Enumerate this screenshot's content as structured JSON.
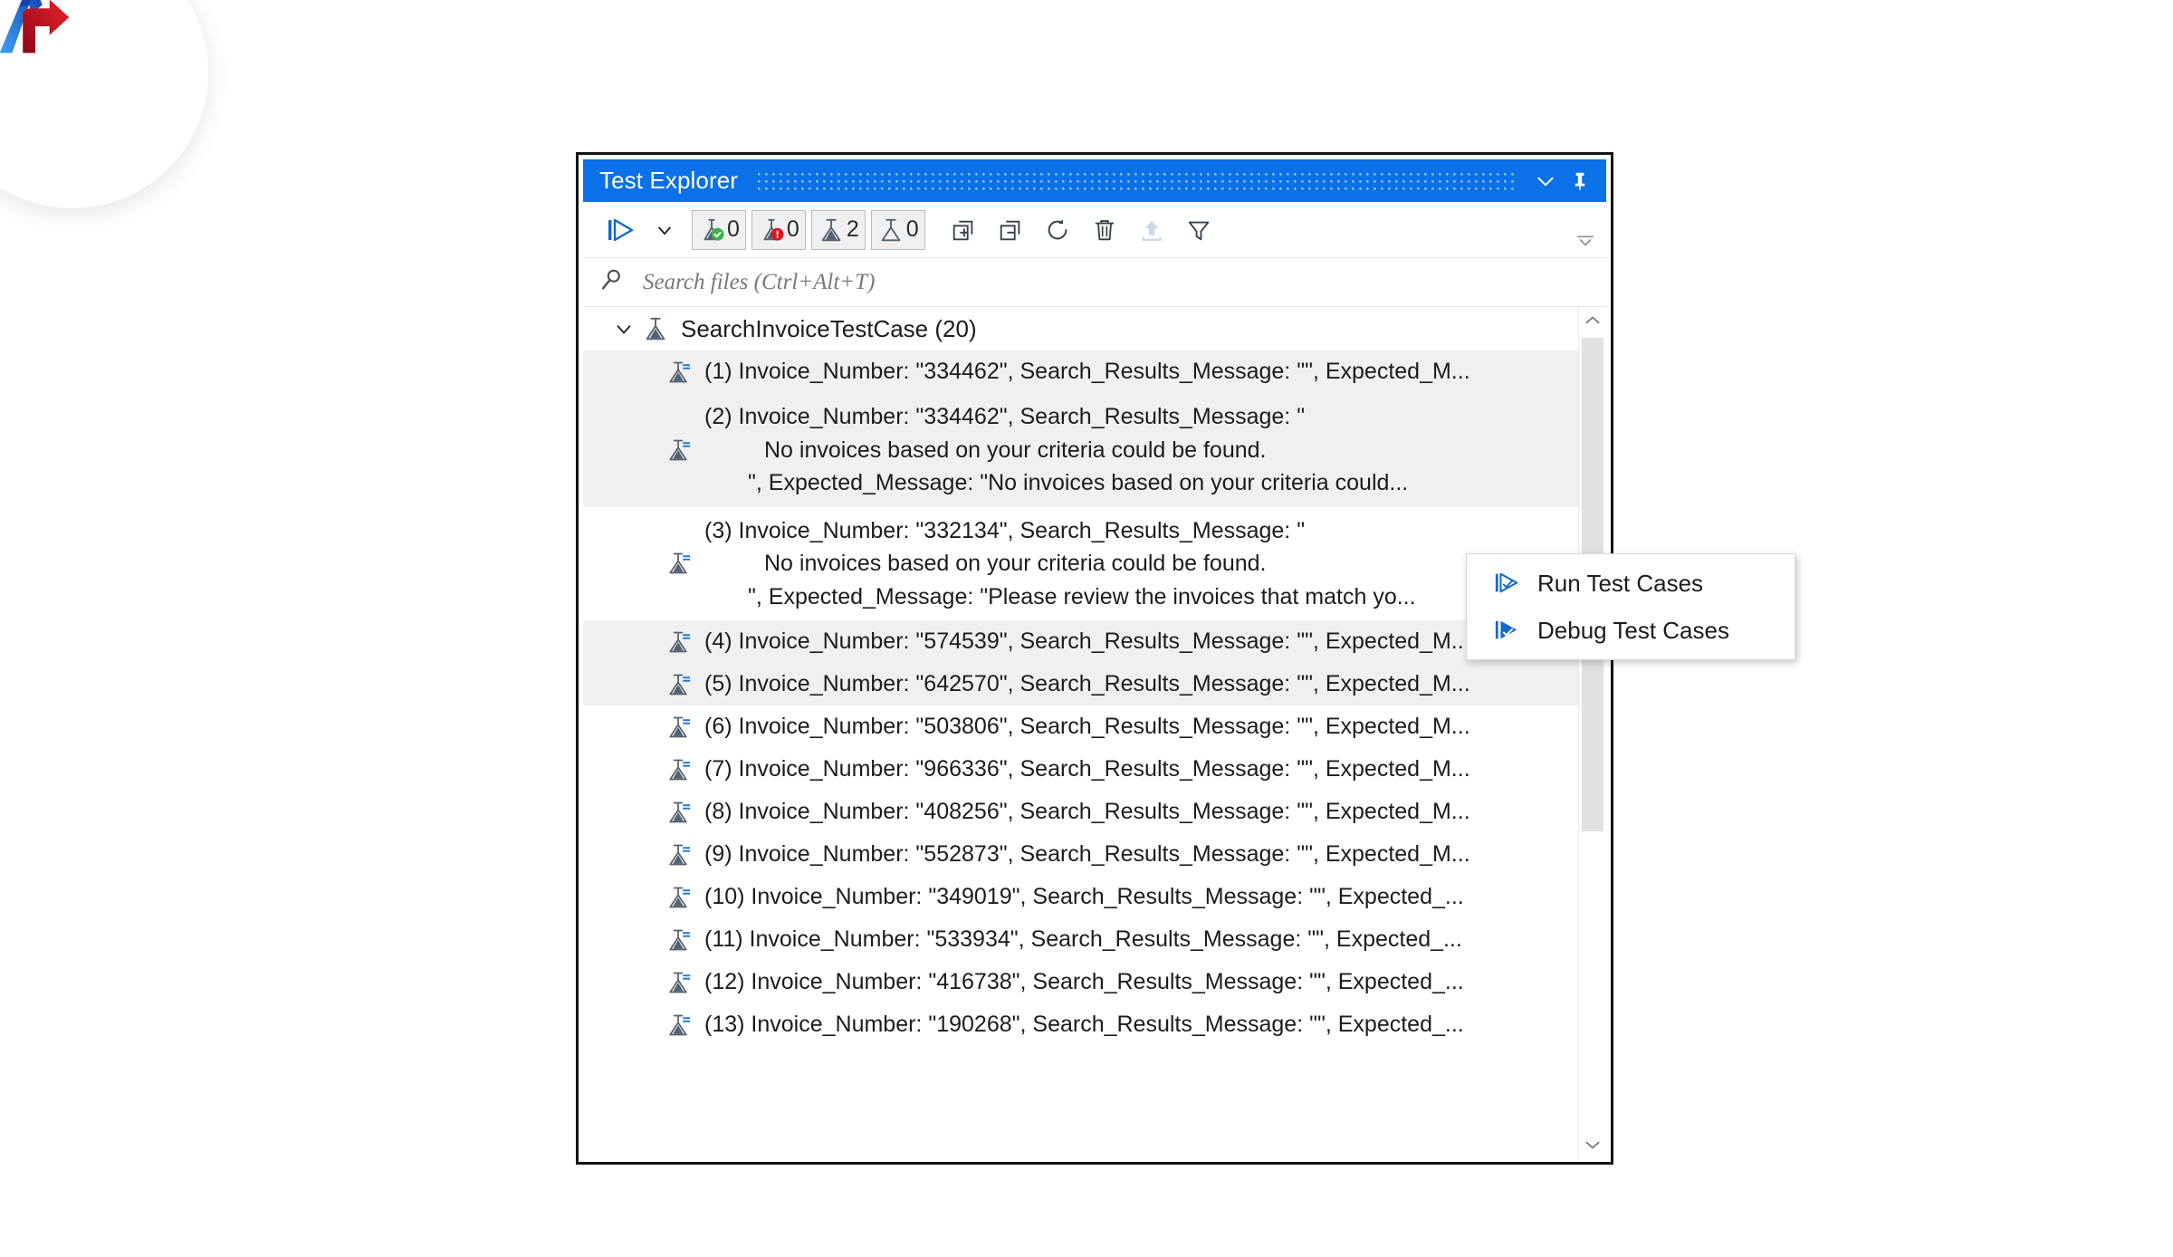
{
  "branding": {
    "logo_name": "accelq-logo"
  },
  "window": {
    "title": "Test Explorer",
    "collapse_icon": "chevron-down-icon",
    "pin_icon": "pin-icon"
  },
  "toolbar": {
    "run_icon": "run-all-tests-icon",
    "run_caret_icon": "chevron-down-icon",
    "counters": [
      {
        "name": "passed-tests-count",
        "icon": "flask-passed-icon",
        "value": "0"
      },
      {
        "name": "failed-tests-count",
        "icon": "flask-failed-icon",
        "value": "0"
      },
      {
        "name": "not-run-tests-count",
        "icon": "flask-notrun-icon",
        "value": "2"
      },
      {
        "name": "skipped-tests-count",
        "icon": "flask-skipped-icon",
        "value": "0"
      }
    ],
    "actions": [
      {
        "name": "expand-all-button",
        "icon": "expand-all-icon"
      },
      {
        "name": "collapse-all-button",
        "icon": "collapse-all-icon"
      },
      {
        "name": "refresh-button",
        "icon": "refresh-icon"
      },
      {
        "name": "clear-all-button",
        "icon": "trash-icon"
      },
      {
        "name": "export-results-button",
        "icon": "upload-icon"
      },
      {
        "name": "filter-button",
        "icon": "funnel-filter-icon"
      }
    ],
    "overflow_icon": "toolbar-overflow-icon",
    "colors": {
      "pass_green": "#3fae49",
      "fail_red": "#d31b27",
      "accent_blue": "#0a71e8",
      "icon_gray": "#546170"
    }
  },
  "search": {
    "icon": "search-icon",
    "value": "",
    "placeholder": "Search files (Ctrl+Alt+T)"
  },
  "tree": {
    "group": {
      "caret_icon": "chevron-down-icon",
      "icon": "flask-icon",
      "label": "SearchInvoiceTestCase (20)"
    },
    "rows": [
      {
        "name": "test-case-row-1",
        "icon": "flask-notrun-icon",
        "multiline": false,
        "highlighted": true,
        "lines": [
          "(1) Invoice_Number: \"334462\", Search_Results_Message: \"\", Expected_M..."
        ]
      },
      {
        "name": "test-case-row-2",
        "icon": "flask-notrun-icon",
        "multiline": true,
        "highlighted": true,
        "lines": [
          "(2) Invoice_Number: \"334462\", Search_Results_Message: \"",
          "No invoices based on your criteria could be found.",
          "\", Expected_Message: \"No invoices based on your criteria could..."
        ]
      },
      {
        "name": "test-case-row-3",
        "icon": "flask-notrun-icon",
        "multiline": true,
        "highlighted": false,
        "lines": [
          "(3) Invoice_Number: \"332134\", Search_Results_Message: \"",
          "No invoices based on your criteria could be found.",
          "\", Expected_Message: \"Please review the invoices that match yo..."
        ]
      },
      {
        "name": "test-case-row-4",
        "icon": "flask-notrun-icon",
        "multiline": false,
        "highlighted": true,
        "lines": [
          "(4) Invoice_Number: \"574539\", Search_Results_Message: \"\", Expected_M..."
        ]
      },
      {
        "name": "test-case-row-5",
        "icon": "flask-notrun-icon",
        "multiline": false,
        "highlighted": true,
        "lines": [
          "(5) Invoice_Number: \"642570\", Search_Results_Message: \"\", Expected_M..."
        ]
      },
      {
        "name": "test-case-row-6",
        "icon": "flask-notrun-icon",
        "multiline": false,
        "highlighted": false,
        "lines": [
          "(6) Invoice_Number: \"503806\", Search_Results_Message: \"\", Expected_M..."
        ]
      },
      {
        "name": "test-case-row-7",
        "icon": "flask-notrun-icon",
        "multiline": false,
        "highlighted": false,
        "lines": [
          "(7) Invoice_Number: \"966336\", Search_Results_Message: \"\", Expected_M..."
        ]
      },
      {
        "name": "test-case-row-8",
        "icon": "flask-notrun-icon",
        "multiline": false,
        "highlighted": false,
        "lines": [
          "(8) Invoice_Number: \"408256\", Search_Results_Message: \"\", Expected_M..."
        ]
      },
      {
        "name": "test-case-row-9",
        "icon": "flask-notrun-icon",
        "multiline": false,
        "highlighted": false,
        "lines": [
          "(9) Invoice_Number: \"552873\", Search_Results_Message: \"\", Expected_M..."
        ]
      },
      {
        "name": "test-case-row-10",
        "icon": "flask-notrun-icon",
        "multiline": false,
        "highlighted": false,
        "lines": [
          "(10) Invoice_Number: \"349019\", Search_Results_Message: \"\", Expected_..."
        ]
      },
      {
        "name": "test-case-row-11",
        "icon": "flask-notrun-icon",
        "multiline": false,
        "highlighted": false,
        "lines": [
          "(11) Invoice_Number: \"533934\", Search_Results_Message: \"\", Expected_..."
        ]
      },
      {
        "name": "test-case-row-12",
        "icon": "flask-notrun-icon",
        "multiline": false,
        "highlighted": false,
        "lines": [
          "(12) Invoice_Number: \"416738\", Search_Results_Message: \"\", Expected_..."
        ]
      },
      {
        "name": "test-case-row-13",
        "icon": "flask-notrun-icon",
        "multiline": false,
        "highlighted": false,
        "lines": [
          "(13) Invoice_Number: \"190268\", Search_Results_Message: \"\", Expected_..."
        ]
      }
    ]
  },
  "scrollbar": {
    "up_icon": "chevron-up-icon",
    "down_icon": "chevron-down-icon"
  },
  "context_menu": {
    "items": [
      {
        "name": "run-test-cases-menu-item",
        "icon": "run-outline-icon",
        "label": "Run Test Cases"
      },
      {
        "name": "debug-test-cases-menu-item",
        "icon": "debug-filled-icon",
        "label": "Debug Test Cases"
      }
    ]
  }
}
